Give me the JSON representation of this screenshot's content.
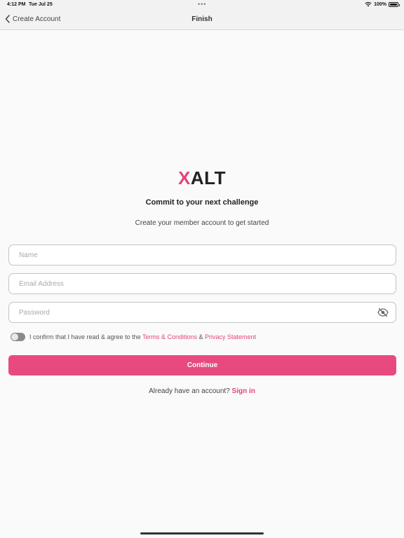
{
  "status_bar": {
    "time": "4:12 PM",
    "date": "Tue Jul 25",
    "dots": "•••",
    "battery": "100%"
  },
  "nav": {
    "back_label": "Create Account",
    "title": "Finish"
  },
  "logo": {
    "accent_letter": "X",
    "rest": "ALT",
    "accent_color": "#e5457b"
  },
  "headline": "Commit to your next challenge",
  "subtitle": "Create your member account to get started",
  "form": {
    "name_placeholder": "Name",
    "email_placeholder": "Email Address",
    "password_placeholder": "Password",
    "name_value": "",
    "email_value": "",
    "password_value": ""
  },
  "consent": {
    "text": "I confirm that I have read & agree to the",
    "terms_link": "Terms & Conditions",
    "joiner": "&",
    "privacy_link": "Privacy Statement",
    "toggle_on": false
  },
  "continue_label": "Continue",
  "signin": {
    "prompt": "Already have an account?",
    "link": "Sign in"
  },
  "colors": {
    "brand": "#e84a7f",
    "background": "#fafafa"
  },
  "icons": {
    "back": "chevron-left-icon",
    "wifi": "wifi-icon",
    "battery": "battery-icon",
    "password_visibility": "eye-slash-icon"
  }
}
